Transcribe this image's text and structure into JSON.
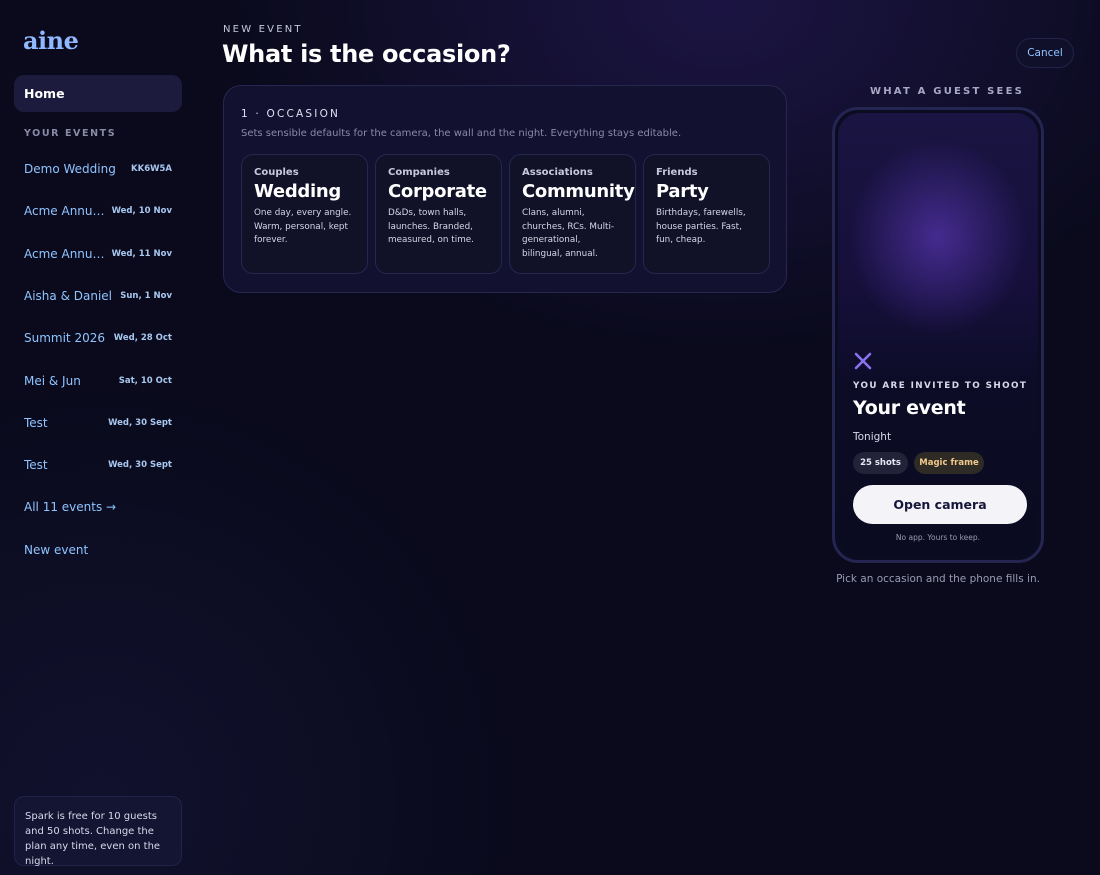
{
  "sidebar": {
    "logo": "aine",
    "home_label": "Home",
    "section_label": "YOUR EVENTS",
    "events": [
      {
        "name": "Demo Wedding",
        "meta": "KK6W5A"
      },
      {
        "name": "Acme Annual …",
        "meta": "Wed, 10 Nov"
      },
      {
        "name": "Acme Annual …",
        "meta": "Wed, 11 Nov"
      },
      {
        "name": "Aisha & Daniel",
        "meta": "Sun, 1 Nov"
      },
      {
        "name": "Summit 2026",
        "meta": "Wed, 28 Oct"
      },
      {
        "name": "Mei & Jun",
        "meta": "Sat, 10 Oct"
      },
      {
        "name": "Test",
        "meta": "Wed, 30 Sept"
      },
      {
        "name": "Test",
        "meta": "Wed, 30 Sept"
      }
    ],
    "all_events_label": "All 11 events →",
    "new_event_label": "New event",
    "plan_note": "Spark is free for 10 guests and 50 shots. Change the plan any time, even on the night."
  },
  "header": {
    "eyebrow": "NEW EVENT",
    "title": "What is the occasion?",
    "cancel_label": "Cancel"
  },
  "occasion": {
    "step_label": "1 · OCCASION",
    "subtitle": "Sets sensible defaults for the camera, the wall and the night. Everything stays editable.",
    "options": [
      {
        "kicker": "Couples",
        "title": "Wedding",
        "desc": "One day, every angle. Warm, personal, kept forever."
      },
      {
        "kicker": "Companies",
        "title": "Corporate",
        "desc": "D&Ds, town halls, launches. Branded, measured, on time."
      },
      {
        "kicker": "Associations",
        "title": "Community",
        "desc": "Clans, alumni, churches, RCs. Multi-generational, bilingual, annual."
      },
      {
        "kicker": "Friends",
        "title": "Party",
        "desc": "Birthdays, farewells, house parties. Fast, fun, cheap."
      }
    ]
  },
  "preview": {
    "label": "WHAT A GUEST SEES",
    "invite_label": "YOU ARE INVITED TO SHOOT",
    "event_title": "Your event",
    "event_when": "Tonight",
    "chip_shots": "25 shots",
    "chip_frame": "Magic frame",
    "open_camera_label": "Open camera",
    "no_app_note": "No app. Yours to keep.",
    "hint": "Pick an occasion and the phone fills in.",
    "icon": "sparkle-x-icon"
  },
  "colors": {
    "background": "#0a0a1c",
    "accent_link": "#8fc4ff",
    "panel": "#121230",
    "phone_glow": "#6941d2",
    "magic_frame_text": "#f2c98a"
  }
}
